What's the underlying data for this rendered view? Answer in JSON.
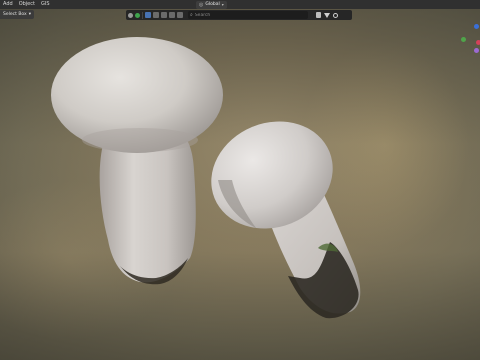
{
  "menubar": {
    "items": [
      "Add",
      "Object",
      "GIS"
    ]
  },
  "select_box": {
    "label": "Select Box",
    "chevron": "chevron-down-icon"
  },
  "header": {
    "transform_orientation": "Global",
    "search": {
      "placeholder": "Search",
      "value": ""
    }
  },
  "gizmo": {
    "colors": {
      "z_axis_blue": "#3a6fd8",
      "y_axis_green": "#4fa54a",
      "x_axis_red": "#d4415a",
      "purple": "#9c6ad2"
    }
  },
  "colors": {
    "mushroom_cap": "#cfcbc6",
    "mushroom_stem": "#c8c2bd",
    "background_bokeh": "#8a7d60"
  },
  "icons": [
    "search-icon",
    "filter-icon",
    "funnel-icon",
    "chevron-down-icon",
    "globe-icon",
    "magnet-icon",
    "proportional-edit-icon"
  ]
}
